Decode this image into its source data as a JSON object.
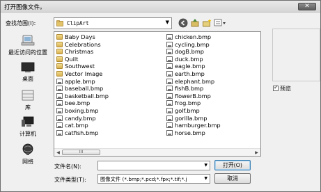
{
  "window": {
    "title": "打开图像文件。",
    "close_label": "✕"
  },
  "lookin": {
    "label": "查找范围(I):",
    "value": "ClipArt"
  },
  "places": [
    {
      "label": "最近访问的位置",
      "icon": "recent-places-icon"
    },
    {
      "label": "桌面",
      "icon": "desktop-icon"
    },
    {
      "label": "库",
      "icon": "libraries-icon"
    },
    {
      "label": "计算机",
      "icon": "computer-icon"
    },
    {
      "label": "网络",
      "icon": "network-icon"
    }
  ],
  "files": {
    "col1": [
      {
        "name": "Baby Days",
        "type": "folder"
      },
      {
        "name": "Celebrations",
        "type": "folder"
      },
      {
        "name": "Christmas",
        "type": "folder"
      },
      {
        "name": "Quilt",
        "type": "folder"
      },
      {
        "name": "Southwest",
        "type": "folder"
      },
      {
        "name": "Vector Image",
        "type": "folder"
      },
      {
        "name": "apple.bmp",
        "type": "bmp"
      },
      {
        "name": "baseball.bmp",
        "type": "bmp"
      },
      {
        "name": "basketball.bmp",
        "type": "bmp"
      },
      {
        "name": "bee.bmp",
        "type": "bmp"
      },
      {
        "name": "boxing.bmp",
        "type": "bmp"
      },
      {
        "name": "candy.bmp",
        "type": "bmp"
      },
      {
        "name": "cat.bmp",
        "type": "bmp"
      },
      {
        "name": "catfish.bmp",
        "type": "bmp"
      }
    ],
    "col2": [
      {
        "name": "chicken.bmp",
        "type": "bmp"
      },
      {
        "name": "cycling.bmp",
        "type": "bmp"
      },
      {
        "name": "dogB.bmp",
        "type": "bmp"
      },
      {
        "name": "duck.bmp",
        "type": "bmp"
      },
      {
        "name": "eagle.bmp",
        "type": "bmp"
      },
      {
        "name": "earth.bmp",
        "type": "bmp"
      },
      {
        "name": "elephant.bmp",
        "type": "bmp"
      },
      {
        "name": "fishB.bmp",
        "type": "bmp"
      },
      {
        "name": "flowerB.bmp",
        "type": "bmp"
      },
      {
        "name": "frog.bmp",
        "type": "bmp"
      },
      {
        "name": "golf.bmp",
        "type": "bmp"
      },
      {
        "name": "gorilla.bmp",
        "type": "bmp"
      },
      {
        "name": "hamburger.bmp",
        "type": "bmp"
      },
      {
        "name": "horse.bmp",
        "type": "bmp"
      }
    ]
  },
  "scrollbar": {
    "thumb_label": "III"
  },
  "preview": {
    "label": "预览",
    "checked": true
  },
  "filename": {
    "label": "文件名(N):",
    "value": ""
  },
  "filetype": {
    "label": "文件类型(T):",
    "value": "图像文件 (*.bmp;*.pcd;*.fpx;*.tif;*.j"
  },
  "buttons": {
    "open": "打开(O)",
    "cancel": "取消"
  }
}
